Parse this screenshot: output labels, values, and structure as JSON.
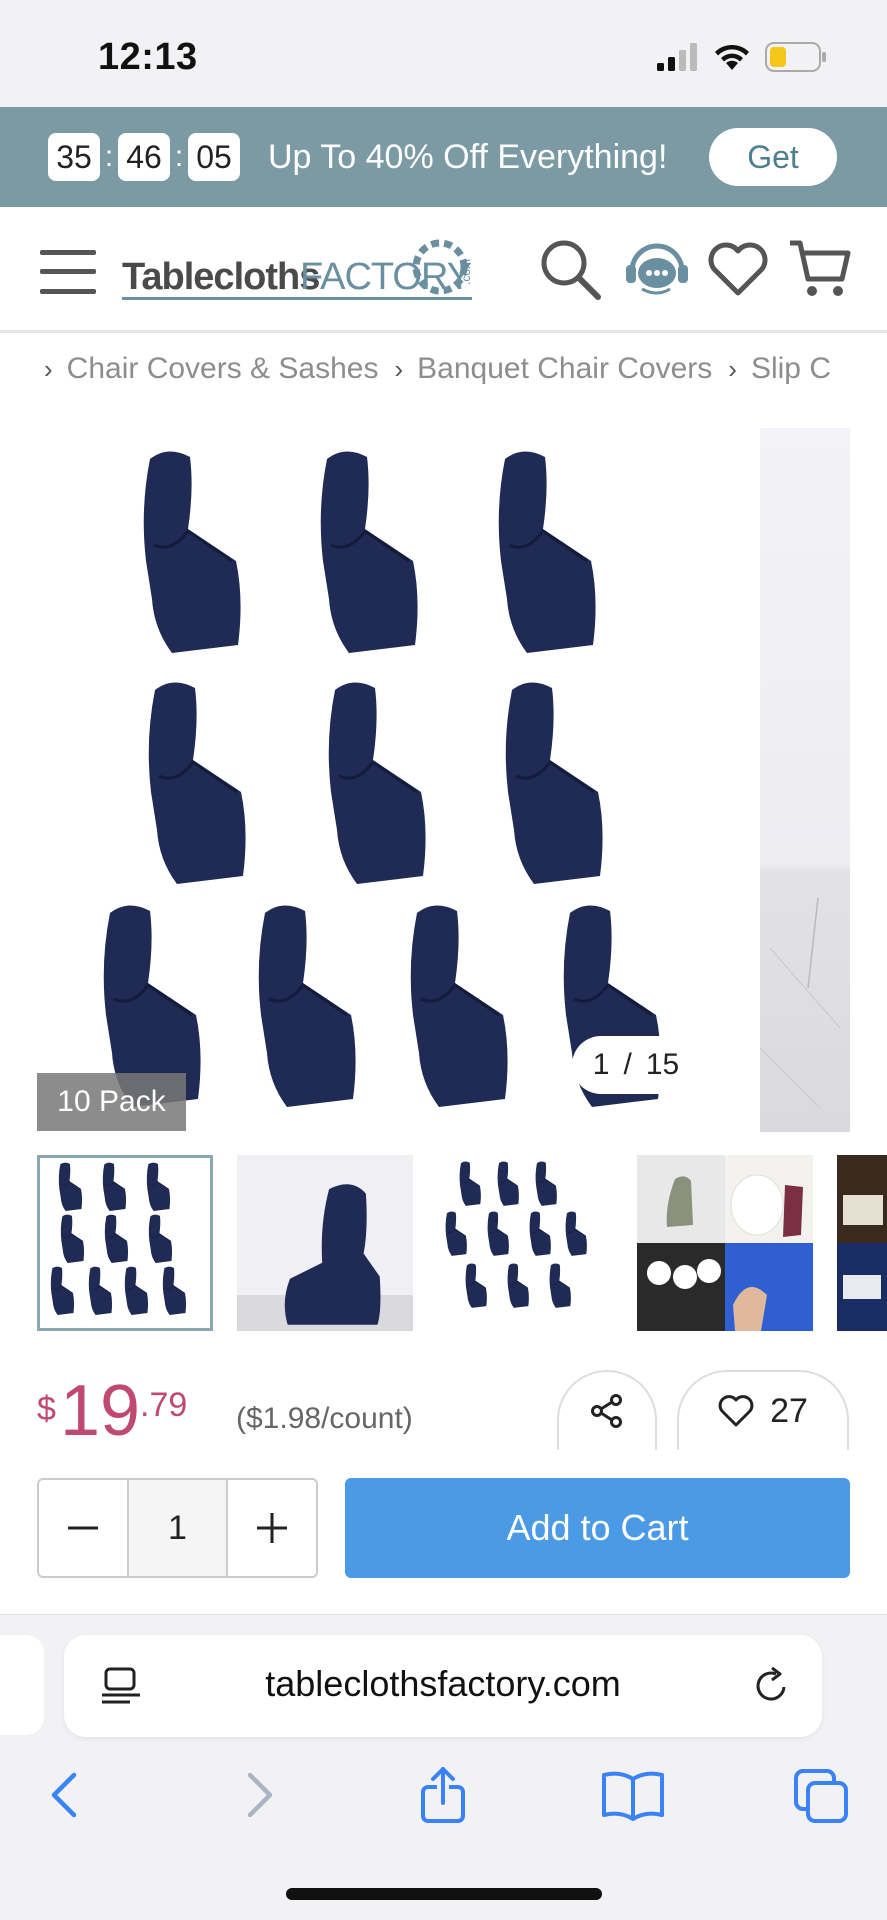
{
  "status_bar": {
    "time": "12:13"
  },
  "promo": {
    "hours": "35",
    "minutes": "46",
    "seconds": "05",
    "separator": ":",
    "text": "Up To 40% Off Everything!",
    "button": "Get"
  },
  "header": {
    "logo_text_1": "Tablecloths",
    "logo_text_2": "FACTORY",
    "logo_text_3": ".com"
  },
  "breadcrumb": {
    "items": [
      "Chair Covers & Sashes",
      "Banquet Chair Covers",
      "Slip C"
    ]
  },
  "gallery": {
    "badge": "10 Pack",
    "current": "1",
    "divider": "/",
    "total": "15",
    "product_color": "#1f2a55"
  },
  "price": {
    "currency": "$",
    "dollars": "19",
    "cents": ".79",
    "per_count": "($1.98/count)",
    "likes": "27"
  },
  "cart": {
    "quantity": "1",
    "add_label": "Add to Cart"
  },
  "browser": {
    "url": "tableclothsfactory.com"
  },
  "colors": {
    "promo_bg": "#7b9aa4",
    "price": "#c0496f",
    "add_to_cart": "#4a9ae6",
    "ios_blue": "#3a82f7"
  }
}
